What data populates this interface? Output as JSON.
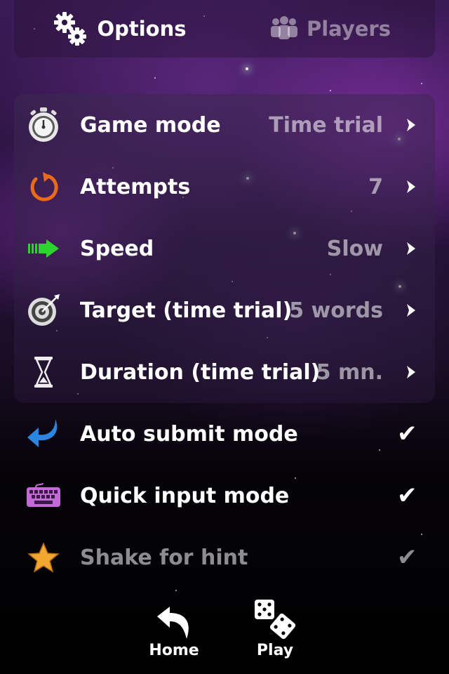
{
  "tabs": [
    {
      "label": "Options",
      "icon": "gears-icon",
      "active": true
    },
    {
      "label": "Players",
      "icon": "players-icon",
      "active": false
    }
  ],
  "settings": [
    {
      "label": "Game mode",
      "value": "Time trial",
      "icon": "stopwatch-icon",
      "control": "chevron"
    },
    {
      "label": "Attempts",
      "value": "7",
      "icon": "retry-arrow-icon",
      "control": "chevron"
    },
    {
      "label": "Speed",
      "value": "Slow",
      "icon": "speed-arrow-icon",
      "control": "chevron"
    },
    {
      "label": "Target (time trial)",
      "value": "5 words",
      "icon": "target-icon",
      "control": "chevron"
    },
    {
      "label": "Duration (time trial)",
      "value": "5 mn.",
      "icon": "hourglass-icon",
      "control": "chevron"
    },
    {
      "label": "Auto submit mode",
      "value": "✔",
      "icon": "curved-arrow-icon",
      "control": "check",
      "checked": true
    },
    {
      "label": "Quick input mode",
      "value": "✔",
      "icon": "keyboard-icon",
      "control": "check",
      "checked": true
    },
    {
      "label": "Shake for hint",
      "value": "✔",
      "icon": "star-icon",
      "control": "check",
      "checked": true,
      "disabled": true
    }
  ],
  "bottom_nav": [
    {
      "label": "Home",
      "icon": "back-arrow-icon"
    },
    {
      "label": "Play",
      "icon": "dice-icon"
    }
  ],
  "colors": {
    "accent_purple": "#6b2d8e",
    "text": "#ffffff",
    "muted_text": "#9c94a4",
    "speed_arrow": "#2ed42e",
    "retry_arrow": "#e86a1a",
    "auto_submit_arrow": "#2a86e0",
    "keyboard": "#c46ad8",
    "star": "#f0a830"
  }
}
